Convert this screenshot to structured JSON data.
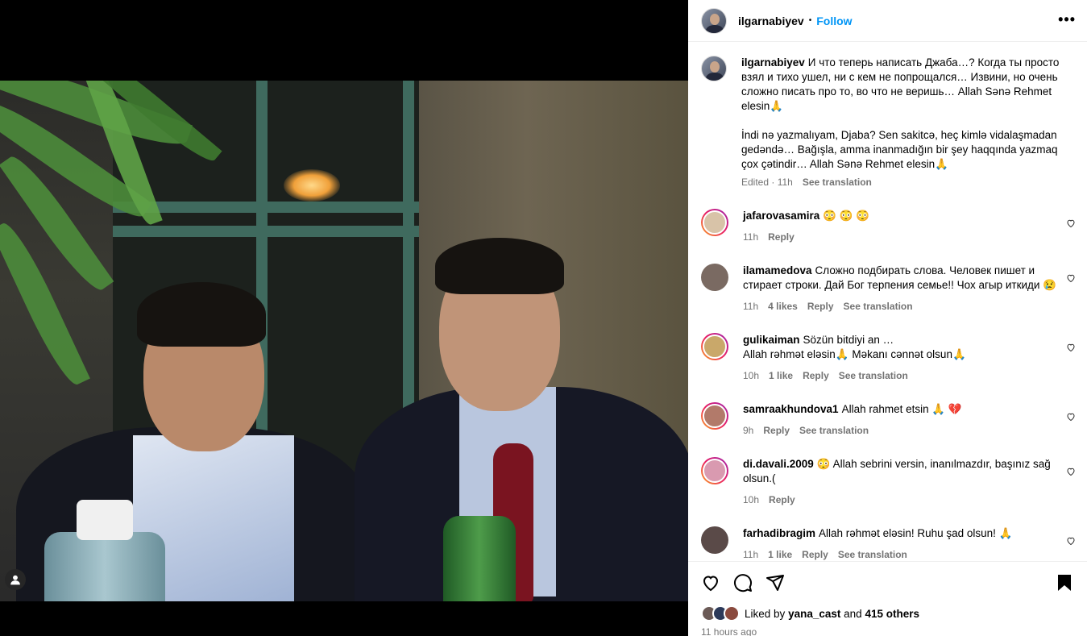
{
  "post": {
    "username": "ilgarnabiyev",
    "follow_label": "Follow",
    "dot": "•",
    "more": "•••",
    "caption": "И что теперь написать Джаба…? Когда ты просто взял и тихо ушел, ни с кем не попрощался… Извини, но очень сложно писать про то, во что не веришь… Allah Sənə Rehmet elesin🙏\n\nİndi nə yazmalıyam, Djaba? Sen sakitcə, heç kimlə vidalaşmadan gedəndə… Bağışla, amma inanmadığın bir şey haqqında yazmaq çox çətindir… Allah Sənə Rehmet elesin🙏",
    "caption_meta_edited": "Edited · 11h",
    "see_translation": "See translation"
  },
  "comments": [
    {
      "user": "jafarovasamira",
      "text": "😳 😳 😳",
      "time": "11h",
      "likes": "",
      "reply": "Reply",
      "translate": "",
      "avatar_color": "#d8c3a8"
    },
    {
      "user": "ilamamedova",
      "text": "Сложно подбирать слова. Человек пишет и стирает строки. Дай Бог терпения семье!! Чох агыр иткиди 😢",
      "time": "11h",
      "likes": "4 likes",
      "reply": "Reply",
      "translate": "See translation",
      "avatar_color": "#7a6a62"
    },
    {
      "user": "gulikaiman",
      "text": "Sözün bitdiyi an …\nAllah rəhmət eləsin🙏 Məkanı cənnət olsun🙏",
      "time": "10h",
      "likes": "1 like",
      "reply": "Reply",
      "translate": "See translation",
      "avatar_color": "#c9a86a"
    },
    {
      "user": "samraakhundova1",
      "text": "Allah rahmet etsin 🙏 💔",
      "time": "9h",
      "likes": "",
      "reply": "Reply",
      "translate": "See translation",
      "avatar_color": "#b27a6a"
    },
    {
      "user": "di.davali.2009",
      "text": "😳  Allah sebrini versin, inanılmazdır, başınız sağ olsun.(",
      "time": "10h",
      "likes": "",
      "reply": "Reply",
      "translate": "",
      "avatar_color": "#d99ab0"
    },
    {
      "user": "farhadibragim",
      "text": "Allah rəhmət eləsin! Ruhu şad olsun! 🙏",
      "time": "11h",
      "likes": "1 like",
      "reply": "Reply",
      "translate": "See translation",
      "avatar_color": "#5a4a48"
    }
  ],
  "footer": {
    "liked_by_prefix": "Liked by",
    "liked_by_user": "yana_cast",
    "and_word": "and",
    "others": "415 others",
    "time": "11 hours ago"
  },
  "icons": {
    "like": "heart-icon",
    "comment": "comment-icon",
    "share": "share-icon",
    "save": "bookmark-icon",
    "tag": "user-tag-icon"
  }
}
